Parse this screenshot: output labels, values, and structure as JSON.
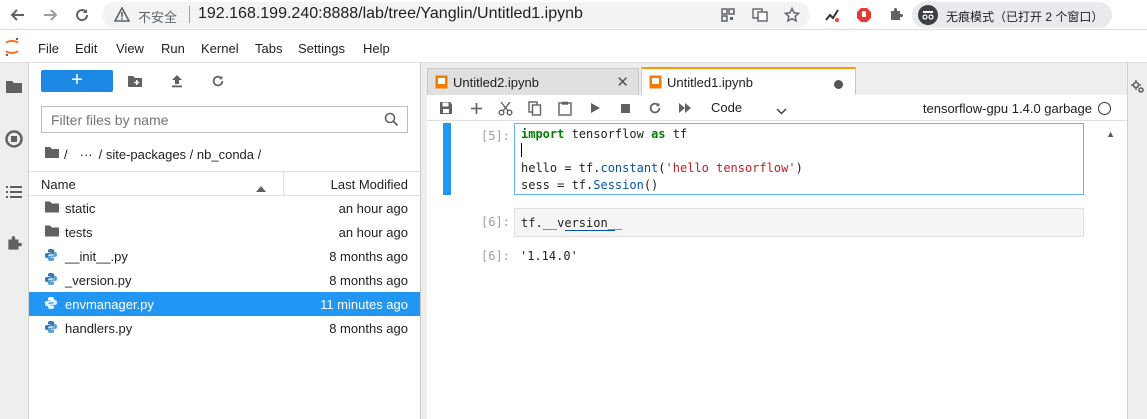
{
  "browser": {
    "insecure_label": "不安全",
    "url": "192.168.199.240:8888/lab/tree/Yanglin/Untitled1.ipynb",
    "incognito_label": "无痕模式（已打开 2 个窗口）"
  },
  "menu": [
    "File",
    "Edit",
    "View",
    "Run",
    "Kernel",
    "Tabs",
    "Settings",
    "Help"
  ],
  "filebrowser": {
    "new_label": "+",
    "filter_placeholder": "Filter files by name",
    "breadcrumb": {
      "root_sep": "/",
      "ellipsis": "···",
      "path": "/ site-packages / nb_conda /"
    },
    "columns": {
      "name": "Name",
      "modified": "Last Modified"
    },
    "files": [
      {
        "name": "static",
        "modified": "an hour ago",
        "kind": "folder"
      },
      {
        "name": "tests",
        "modified": "an hour ago",
        "kind": "folder"
      },
      {
        "name": "__init__.py",
        "modified": "8 months ago",
        "kind": "python"
      },
      {
        "name": "_version.py",
        "modified": "8 months ago",
        "kind": "python"
      },
      {
        "name": "envmanager.py",
        "modified": "11 minutes ago",
        "kind": "python",
        "selected": true
      },
      {
        "name": "handlers.py",
        "modified": "8 months ago",
        "kind": "python"
      }
    ]
  },
  "tabs": [
    {
      "label": "Untitled2.ipynb",
      "active": false
    },
    {
      "label": "Untitled1.ipynb",
      "active": true
    }
  ],
  "notebook": {
    "cell_type": "Code",
    "kernel": "tensorflow-gpu 1.4.0 garbage",
    "cells": [
      {
        "prompt": "[5]:",
        "lines": [
          [
            [
              "kw",
              "import"
            ],
            [
              "",
              " tensorflow "
            ],
            [
              "kw",
              "as"
            ],
            [
              "",
              " tf"
            ]
          ],
          [],
          [
            [
              "",
              "hello = tf."
            ],
            [
              "nm",
              "constant"
            ],
            [
              "",
              "("
            ],
            [
              "st",
              "'hello tensorflow'"
            ],
            [
              "",
              ")"
            ]
          ],
          [
            [
              "",
              "sess = tf."
            ],
            [
              "nm",
              "Session"
            ],
            [
              "",
              "()"
            ]
          ]
        ]
      },
      {
        "prompt": "[6]:",
        "code": "tf.__version__",
        "output_prompt": "[6]:",
        "output": "'1.14.0'"
      }
    ]
  },
  "colors": {
    "accent": "#2196f3",
    "tab_accent": "#ff9800",
    "new_button": "#1e88e5"
  }
}
